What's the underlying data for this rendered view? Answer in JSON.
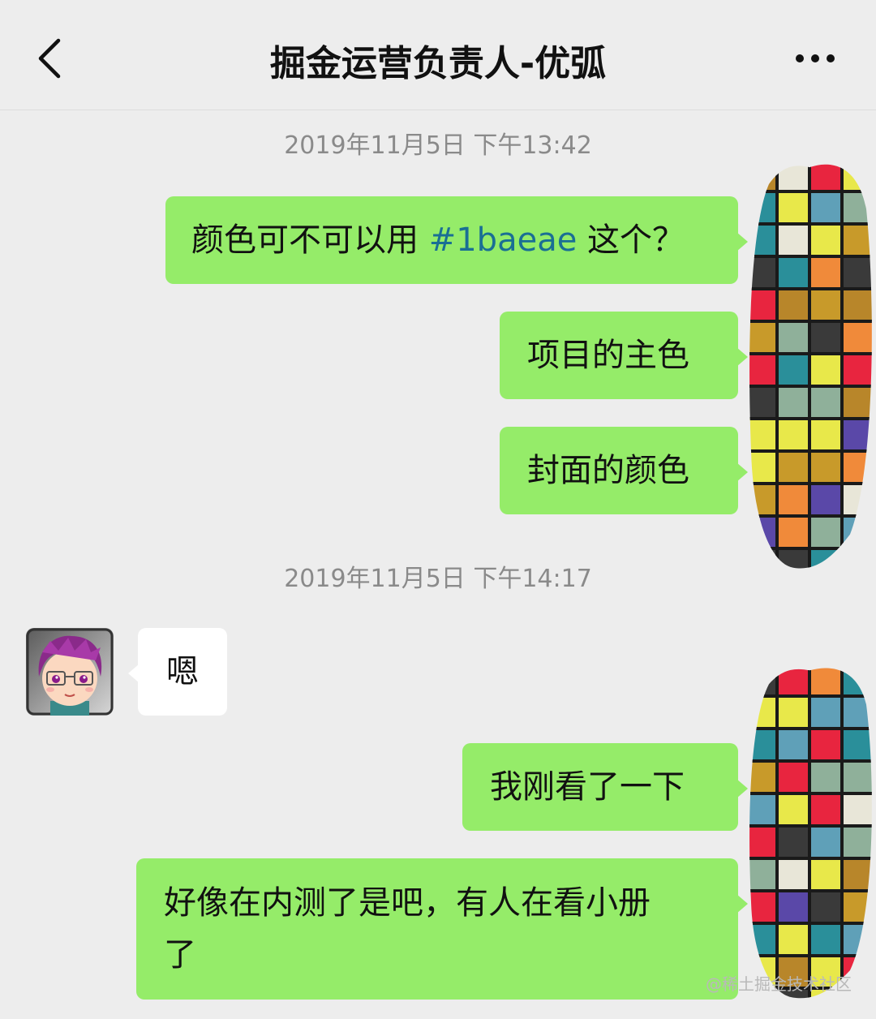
{
  "header": {
    "title": "掘金运营负责人-优弧"
  },
  "messages": [
    {
      "type": "timestamp",
      "text": "2019年11月5日 下午13:42"
    },
    {
      "type": "me",
      "text_before": "颜色可不可以用 ",
      "highlight": "#1baeae",
      "text_after": " 这个？"
    },
    {
      "type": "me",
      "text": "项目的主色"
    },
    {
      "type": "me",
      "text": "封面的颜色"
    },
    {
      "type": "timestamp",
      "text": "2019年11月5日 下午14:17"
    },
    {
      "type": "other",
      "text": "嗯"
    },
    {
      "type": "me",
      "text": "我刚看了一下"
    },
    {
      "type": "me",
      "text_line1": "好像在内测了是吧，有人在看小册",
      "text_line2": "了"
    }
  ],
  "colors": {
    "background": "#ededed",
    "my_bubble": "#95ec69",
    "other_bubble": "#ffffff",
    "hashtag": "#1a6f94",
    "timestamp": "#8a8a8a"
  },
  "mosaic_palette": [
    "#e8253f",
    "#2a8f9a",
    "#c89a2a",
    "#3a3a3a",
    "#e8e84a",
    "#5fa0b8",
    "#8fb09a",
    "#f08a3a",
    "#5a48a8",
    "#b8862a",
    "#e8e6d8"
  ],
  "watermark": "@稀土掘金技术社区"
}
